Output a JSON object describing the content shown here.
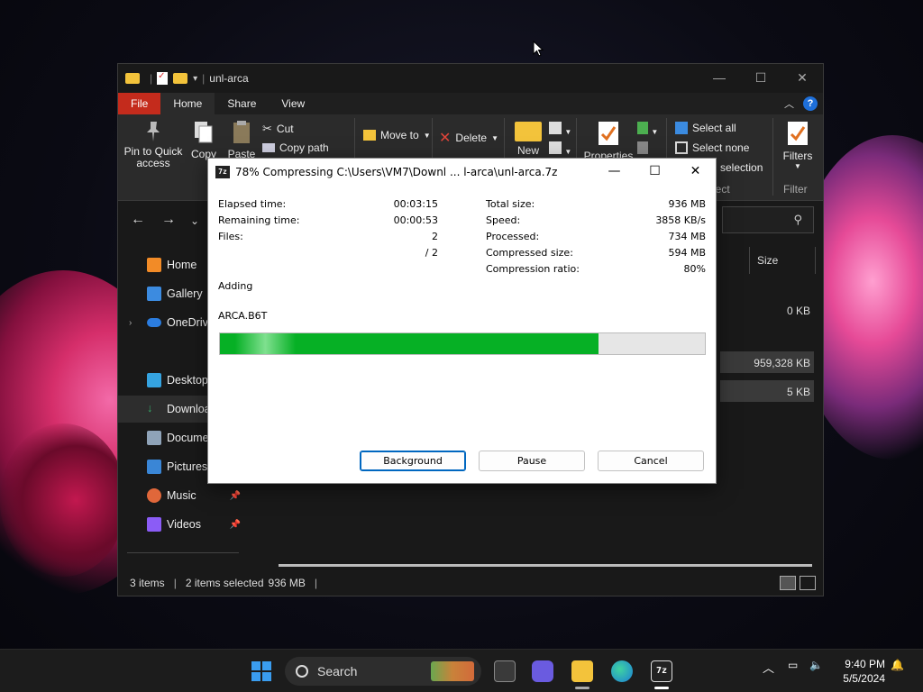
{
  "explorer": {
    "title": "unl-arca",
    "tabs": [
      "File",
      "Home",
      "Share",
      "View"
    ],
    "ribbon": {
      "pin_label": "Pin to Quick access",
      "copy_label": "Copy",
      "paste_label": "Paste",
      "cut_label": "Cut",
      "copy_path_label": "Copy path",
      "move_to_label": "Move to",
      "delete_label": "Delete",
      "new_label": "New",
      "properties_label": "Properties",
      "select_all_label": "Select all",
      "select_none_label": "Select none",
      "invert_selection_label": "selection",
      "select_group_label": "lect",
      "filters_label": "Filters",
      "filter_group_label": "Filter"
    },
    "sidebar": [
      {
        "label": "Home",
        "icon": "home-icon",
        "color": "#f28b27"
      },
      {
        "label": "Gallery",
        "icon": "gallery-icon",
        "color": "#3c8be0"
      },
      {
        "label": "OneDrive",
        "icon": "onedrive-icon",
        "color": "#2b7de0"
      },
      {
        "label": "Desktop",
        "icon": "desktop-icon",
        "color": "#35a3e0"
      },
      {
        "label": "Downloads",
        "icon": "downloads-icon",
        "color": "#36b06b"
      },
      {
        "label": "Documents",
        "icon": "documents-icon",
        "color": "#8fa3b8"
      },
      {
        "label": "Pictures",
        "icon": "pictures-icon",
        "color": "#3a86d6"
      },
      {
        "label": "Music",
        "icon": "music-icon",
        "color": "#e0673a"
      },
      {
        "label": "Videos",
        "icon": "videos-icon",
        "color": "#8b5cf6"
      }
    ],
    "column_size": "Size",
    "sizes": [
      "0 KB",
      "959,328 KB",
      "5 KB"
    ],
    "status": {
      "items": "3 items",
      "selected": "2 items selected",
      "size": "936 MB"
    }
  },
  "dialog": {
    "title": "78% Compressing C:\\Users\\VM7\\Downl ... l-arca\\unl-arca.7z",
    "icon_text": "7z",
    "left": [
      {
        "label": "Elapsed time:",
        "value": "00:03:15"
      },
      {
        "label": "Remaining time:",
        "value": "00:00:53"
      },
      {
        "label": "Files:",
        "value": "2"
      },
      {
        "label": "",
        "value": "/ 2"
      }
    ],
    "right": [
      {
        "label": "Total size:",
        "value": "936 MB"
      },
      {
        "label": "Speed:",
        "value": "3858 KB/s"
      },
      {
        "label": "Processed:",
        "value": "734 MB"
      },
      {
        "label": "Compressed size:",
        "value": "594 MB"
      },
      {
        "label": "Compression ratio:",
        "value": "80%"
      }
    ],
    "action": "Adding",
    "current_file": "ARCA.B6T",
    "progress_percent": 78,
    "buttons": {
      "background": "Background",
      "pause": "Pause",
      "cancel": "Cancel"
    }
  },
  "taskbar": {
    "search_label": "Search",
    "time": "9:40 PM",
    "date": "5/5/2024"
  }
}
